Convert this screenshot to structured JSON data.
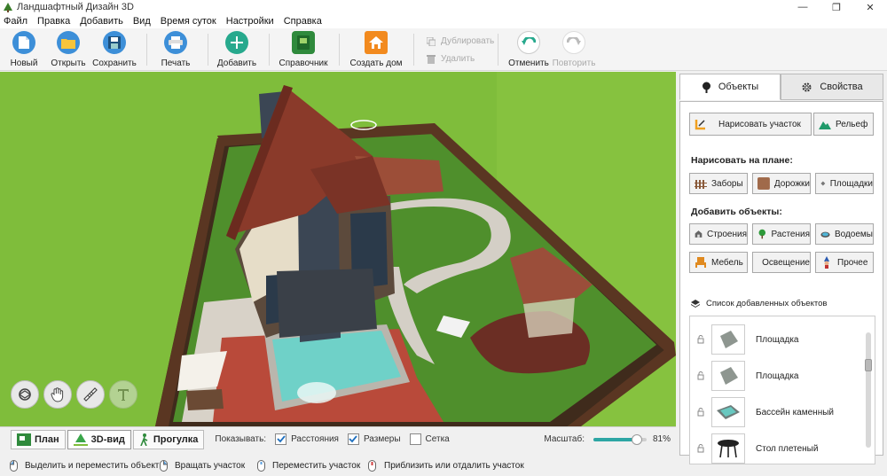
{
  "window": {
    "title": "Ландшафтный Дизайн 3D",
    "controls": [
      "—",
      "❐",
      "✕"
    ]
  },
  "menu": [
    "Файл",
    "Правка",
    "Добавить",
    "Вид",
    "Время суток",
    "Настройки",
    "Справка"
  ],
  "toolbar": {
    "new": "Новый",
    "open": "Открыть",
    "save": "Сохранить",
    "print": "Печать",
    "add": "Добавить",
    "guide": "Справочник",
    "build_house": "Создать дом",
    "duplicate": "Дублировать",
    "delete": "Удалить",
    "undo": "Отменить",
    "redo": "Повторить"
  },
  "viewbar": {
    "tabs": [
      "План",
      "3D-вид",
      "Прогулка"
    ],
    "active_tab": "3D-вид",
    "show_label": "Показывать:",
    "checks": [
      {
        "label": "Расстояния",
        "checked": true
      },
      {
        "label": "Размеры",
        "checked": true
      },
      {
        "label": "Сетка",
        "checked": false
      }
    ],
    "scale_label": "Масштаб:",
    "scale_value": "81%",
    "scale_fraction": 0.81
  },
  "status": {
    "select_move": "Выделить и переместить объект",
    "rotate": "Вращать участок",
    "move": "Переместить участок",
    "zoom": "Приблизить или отдалить участок"
  },
  "panel": {
    "tab_objects": "Объекты",
    "tab_properties": "Свойства",
    "draw_plot": "Нарисовать участок",
    "relief": "Рельеф",
    "draw_on_plan": "Нарисовать на плане:",
    "fences": "Заборы",
    "paths": "Дорожки",
    "platforms": "Площадки",
    "add_objects": "Добавить объекты:",
    "buildings": "Строения",
    "plants": "Растения",
    "ponds": "Водоемы",
    "furniture": "Мебель",
    "lighting": "Освещение",
    "other": "Прочее",
    "list_title": "Список добавленных объектов",
    "items": [
      "Площадка",
      "Площадка",
      "Бассейн каменный",
      "Стол плетеный"
    ]
  },
  "colors": {
    "accent": "#2da6a4",
    "grass": "#7fbd3b",
    "roof": "#8a3a2a"
  }
}
